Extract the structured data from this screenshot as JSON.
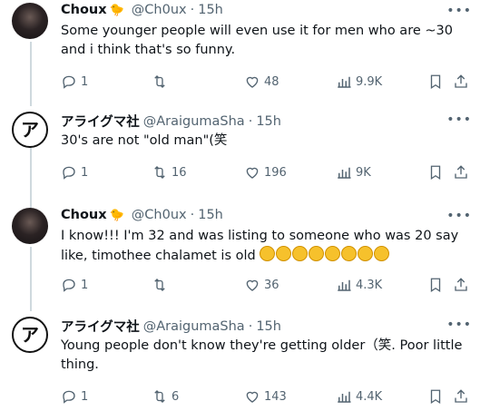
{
  "tweets": [
    {
      "avatar": "choux-avatar",
      "name": "Choux",
      "emoji": "chick",
      "handle": "@Ch0ux",
      "time": "15h",
      "text": "Some younger people will even use it for men who are ~30 and i think that's so funny.",
      "reply": "1",
      "retweet": "",
      "like": "48",
      "views": "9.9K"
    },
    {
      "avatar": "araiguma-avatar",
      "logo": "ア",
      "name": "アライグマ社",
      "handle": "@AraigumaSha",
      "time": "15h",
      "text": "30's are not \"old man\"(笑",
      "reply": "1",
      "retweet": "16",
      "like": "196",
      "views": "9K"
    },
    {
      "avatar": "choux-avatar",
      "name": "Choux",
      "emoji": "chick",
      "handle": "@Ch0ux",
      "time": "15h",
      "text": "I know!!! I'm 32 and was listing to someone who was 20 say like, timothee chalamet is old",
      "reply": "1",
      "retweet": "",
      "like": "36",
      "views": "4.3K"
    },
    {
      "avatar": "araiguma-avatar",
      "logo": "ア",
      "name": "アライグマ社",
      "handle": "@AraigumaSha",
      "time": "15h",
      "text": "Young people don't know they're getting older（笑. Poor little thing.",
      "reply": "1",
      "retweet": "6",
      "like": "143",
      "views": "4.4K"
    }
  ],
  "separator": "·",
  "colors": {
    "text": "#0f1419",
    "muted": "#536471",
    "thread": "#cfd9de"
  }
}
